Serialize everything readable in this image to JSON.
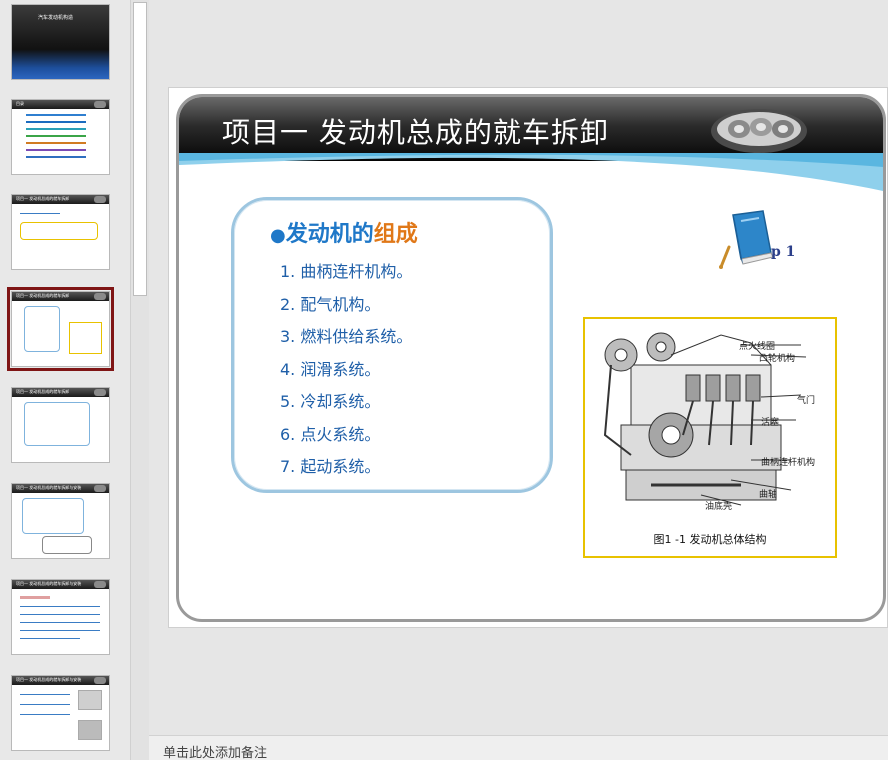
{
  "thumbnails": [
    {
      "title": "汽车发动机构造"
    },
    {
      "title": "目录"
    },
    {
      "title": "项目一 发动机总成的就车拆卸"
    },
    {
      "title": "项目一 发动机总成的就车拆卸",
      "selected": true
    },
    {
      "title": "项目一 发动机总成的就车拆卸"
    },
    {
      "title": "项目一 发动机总成的就车拆卸与安装"
    },
    {
      "title": "项目一 发动机总成的就车拆卸与安装"
    },
    {
      "title": "项目一 发动机总成的就车拆卸与安装"
    }
  ],
  "slide": {
    "title": "项目一 发动机总成的就车拆卸",
    "heading_main": "发动机的",
    "heading_accent": "组成",
    "heading_bullet": "●",
    "items": [
      "1. 曲柄连杆机构。",
      "2. 配气机构。",
      "3. 燃料供给系统。",
      "4. 润滑系统。",
      "5. 冷却系统。",
      "6. 点火系统。",
      "7. 起动系统。"
    ],
    "page_ref": "p 1",
    "figure": {
      "caption": "图1 -1 发动机总体结构",
      "labels": {
        "ignition_coil": "点火线圈",
        "camshaft": "凸轮机构",
        "valve": "气门",
        "piston": "活塞",
        "crank_mechanism": "曲柄连杆机构",
        "crankshaft": "曲轴",
        "oil_pan": "油底壳"
      }
    }
  },
  "notes": {
    "placeholder": "单击此处添加备注"
  },
  "colors": {
    "heading_blue": "#1f78c8",
    "heading_orange": "#e07818",
    "list_blue": "#1f5fa8",
    "selected_thumb": "#7f1515",
    "figure_border": "#e8c200"
  }
}
